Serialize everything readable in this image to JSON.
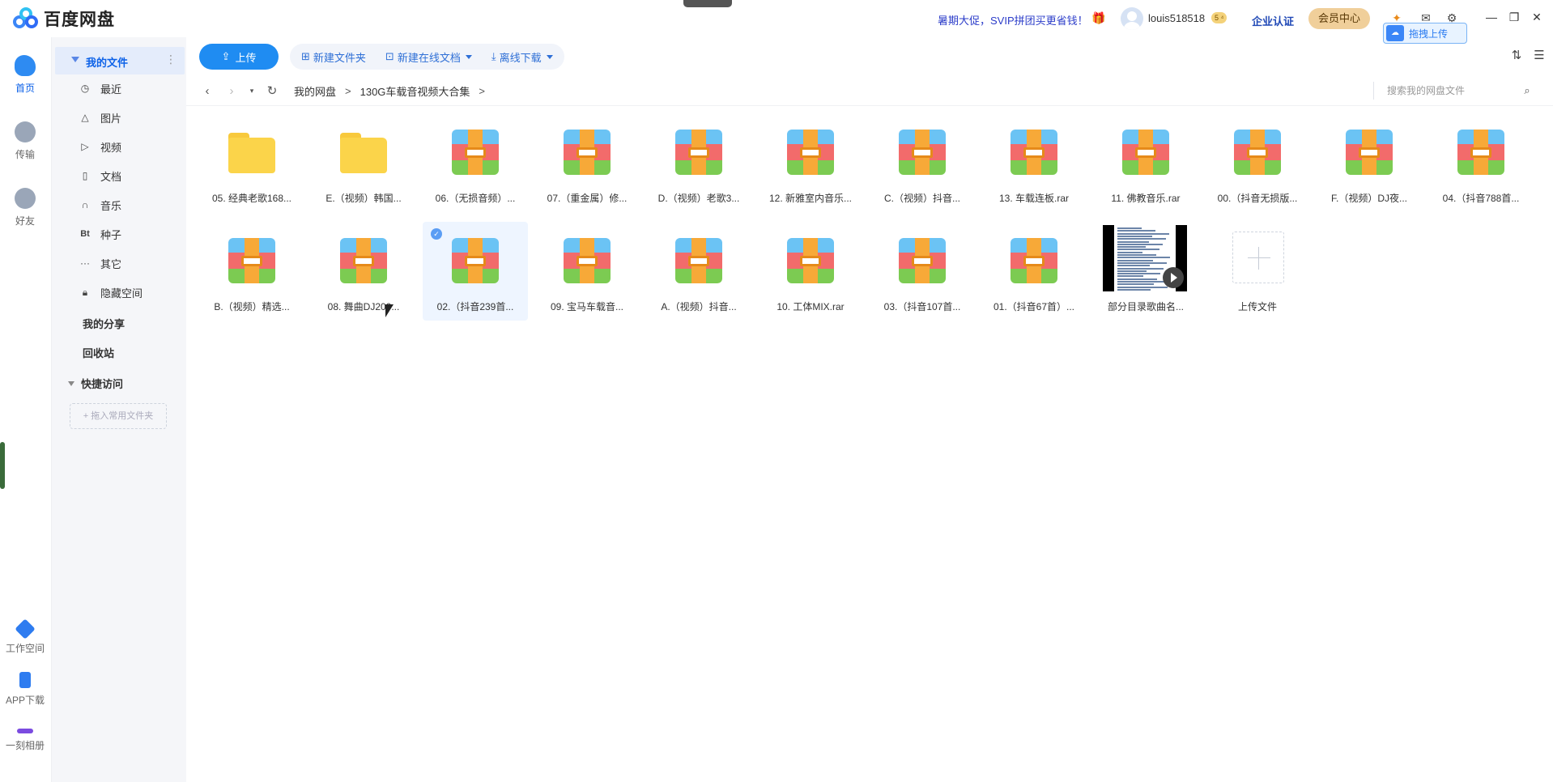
{
  "app": {
    "title": "百度网盘"
  },
  "topbar": {
    "promo": "暑期大促，SVIP拼团买更省钱！",
    "username": "louis518518",
    "level": "5 ⁴",
    "biz_link": "企业认证",
    "vip_center": "会员中心",
    "drag_upload": "拖拽上传"
  },
  "rail": {
    "items": [
      {
        "label": "首页",
        "icon": "cloud-icon"
      },
      {
        "label": "传输",
        "icon": "transfer-icon"
      },
      {
        "label": "好友",
        "icon": "friends-icon"
      },
      {
        "label": "工作空间",
        "icon": "workspace-icon"
      },
      {
        "label": "APP下载",
        "icon": "phone-icon"
      },
      {
        "label": "一刻相册",
        "icon": "album-icon"
      }
    ]
  },
  "sidebar": {
    "my_files": "我的文件",
    "items": [
      {
        "label": "最近",
        "icon": "clock-icon"
      },
      {
        "label": "图片",
        "icon": "image-icon"
      },
      {
        "label": "视频",
        "icon": "play-icon"
      },
      {
        "label": "文档",
        "icon": "document-icon"
      },
      {
        "label": "音乐",
        "icon": "headphones-icon"
      },
      {
        "label": "种子",
        "icon": "torrent-icon"
      },
      {
        "label": "其它",
        "icon": "more-icon"
      },
      {
        "label": "隐藏空间",
        "icon": "lock-icon"
      }
    ],
    "my_share": "我的分享",
    "recycle": "回收站",
    "quick_access": "快捷访问",
    "drop_hint": "+ 拖入常用文件夹"
  },
  "toolbar": {
    "upload": "上传",
    "new_folder": "新建文件夹",
    "new_online_doc": "新建在线文档",
    "offline_download": "离线下载"
  },
  "nav": {
    "crumbs": [
      "我的网盘",
      "130G车载音视频大合集"
    ],
    "search_placeholder": "搜索我的网盘文件"
  },
  "files": [
    {
      "name": "05. 经典老歌168...",
      "type": "folder"
    },
    {
      "name": "E.（视频）韩国...",
      "type": "folder"
    },
    {
      "name": "06.（无损音频）...",
      "type": "rar"
    },
    {
      "name": "07.（重金属）修...",
      "type": "rar"
    },
    {
      "name": "D.（视频）老歌3...",
      "type": "rar"
    },
    {
      "name": "12. 新雅室内音乐...",
      "type": "rar"
    },
    {
      "name": "C.（视频）抖音...",
      "type": "rar"
    },
    {
      "name": "13. 车载连板.rar",
      "type": "rar"
    },
    {
      "name": "11. 佛教音乐.rar",
      "type": "rar"
    },
    {
      "name": "00.（抖音无损版...",
      "type": "rar"
    },
    {
      "name": "F.（视频）DJ夜...",
      "type": "rar"
    },
    {
      "name": "04.（抖音788首...",
      "type": "rar"
    },
    {
      "name": "B.（视频）精选...",
      "type": "rar"
    },
    {
      "name": "08. 舞曲DJ200...",
      "type": "rar"
    },
    {
      "name": "02.（抖音239首...",
      "type": "rar",
      "selected": true
    },
    {
      "name": "09. 宝马车载音...",
      "type": "rar"
    },
    {
      "name": "A.（视频）抖音...",
      "type": "rar"
    },
    {
      "name": "10. 工体MIX.rar",
      "type": "rar"
    },
    {
      "name": "03.（抖音107首...",
      "type": "rar"
    },
    {
      "name": "01.（抖音67首）...",
      "type": "rar"
    },
    {
      "name": "部分目录歌曲名...",
      "type": "video"
    },
    {
      "name": "上传文件",
      "type": "upload"
    }
  ]
}
